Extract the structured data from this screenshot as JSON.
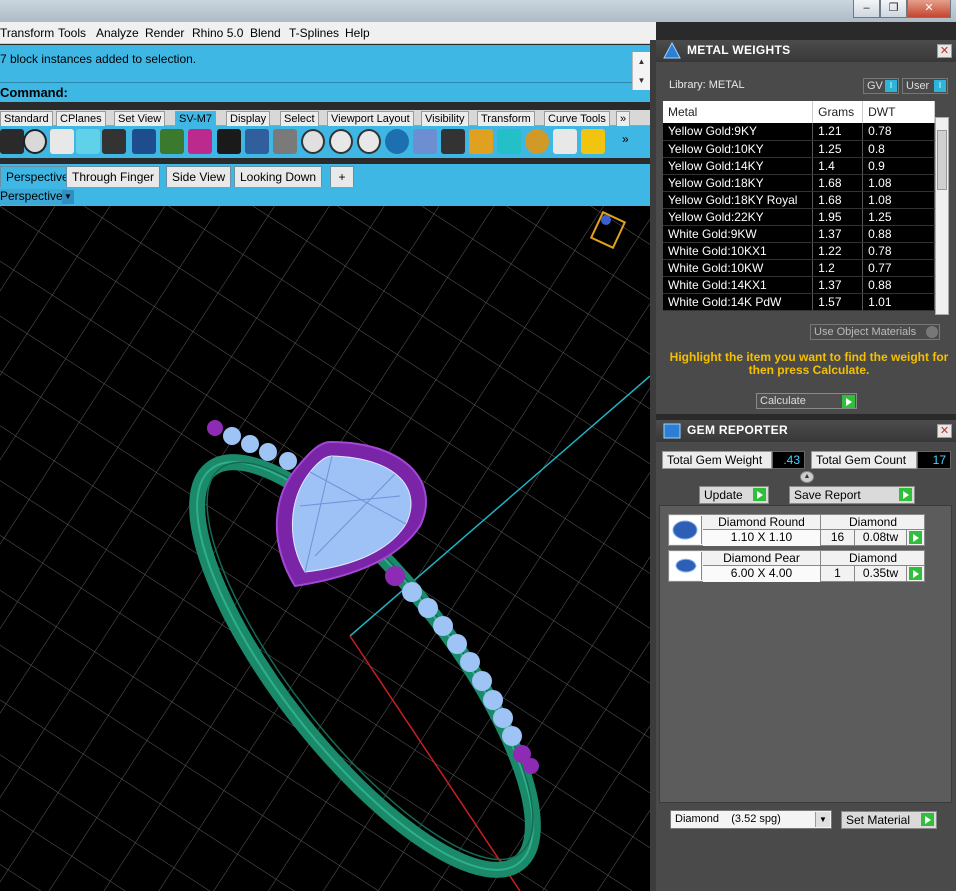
{
  "window": {
    "minimize_label": "‒",
    "restore_label": "❐",
    "close_label": "✕"
  },
  "menu": [
    "Transform",
    "Tools",
    "Analyze",
    "Render",
    "Rhino 5.0",
    "Blend",
    "T-Splines",
    "Help"
  ],
  "command": {
    "history_line": "7 block instances added to selection.",
    "prompt": "Command:"
  },
  "toolbar_tabs": [
    "Standard",
    "CPlanes",
    "Set View",
    "SV-M7",
    "Display",
    "Select",
    "Viewport Layout",
    "Visibility",
    "Transform",
    "Curve Tools"
  ],
  "toolbar_more": "»",
  "viewport_tabs": [
    "Perspective",
    "Through Finger",
    "Side View",
    "Looking Down"
  ],
  "viewport_add": "+",
  "viewport_label": "Perspective",
  "metal_weights": {
    "title": "METAL WEIGHTS",
    "library_label": "Library: METAL",
    "gv_label": "GV",
    "user_label": "User",
    "columns": [
      "Metal",
      "Grams",
      "DWT"
    ],
    "rows": [
      [
        "Yellow Gold:9KY",
        "1.21",
        "0.78"
      ],
      [
        "Yellow Gold:10KY",
        "1.25",
        "0.8"
      ],
      [
        "Yellow Gold:14KY",
        "1.4",
        "0.9"
      ],
      [
        "Yellow Gold:18KY",
        "1.68",
        "1.08"
      ],
      [
        "Yellow Gold:18KY Royal",
        "1.68",
        "1.08"
      ],
      [
        "Yellow Gold:22KY",
        "1.95",
        "1.25"
      ],
      [
        "White Gold:9KW",
        "1.37",
        "0.88"
      ],
      [
        "White Gold:10KX1",
        "1.22",
        "0.78"
      ],
      [
        "White Gold:10KW",
        "1.2",
        "0.77"
      ],
      [
        "White Gold:14KX1",
        "1.37",
        "0.88"
      ],
      [
        "White Gold:14K PdW",
        "1.57",
        "1.01"
      ]
    ],
    "use_object_materials": "Use Object Materials",
    "hint": "Highlight the item you want to find the weight for then press Calculate.",
    "calculate_label": "Calculate"
  },
  "gem_reporter": {
    "title": "GEM REPORTER",
    "total_weight_label": "Total Gem Weight",
    "total_weight": ".43",
    "total_count_label": "Total Gem Count",
    "total_count": "17",
    "update_label": "Update",
    "save_report_label": "Save Report",
    "gems": [
      {
        "name": "Diamond Round",
        "size": "1.10 X 1.10",
        "type": "Diamond",
        "count": "16",
        "weight": "0.08tw"
      },
      {
        "name": "Diamond Pear",
        "size": "6.00 X 4.00",
        "type": "Diamond",
        "count": "1",
        "weight": "0.35tw"
      }
    ],
    "material": "Diamond    (3.52 spg)",
    "set_material_label": "Set Material"
  },
  "colors": {
    "accent": "#3fb7e5",
    "viewport_bg": "#000000",
    "panel_bg": "#4a4a4a",
    "hint_text": "#f5c000",
    "ring_band": "#1f8c6e",
    "prongs": "#8e2bb5",
    "stones": "#8fb7f2"
  }
}
